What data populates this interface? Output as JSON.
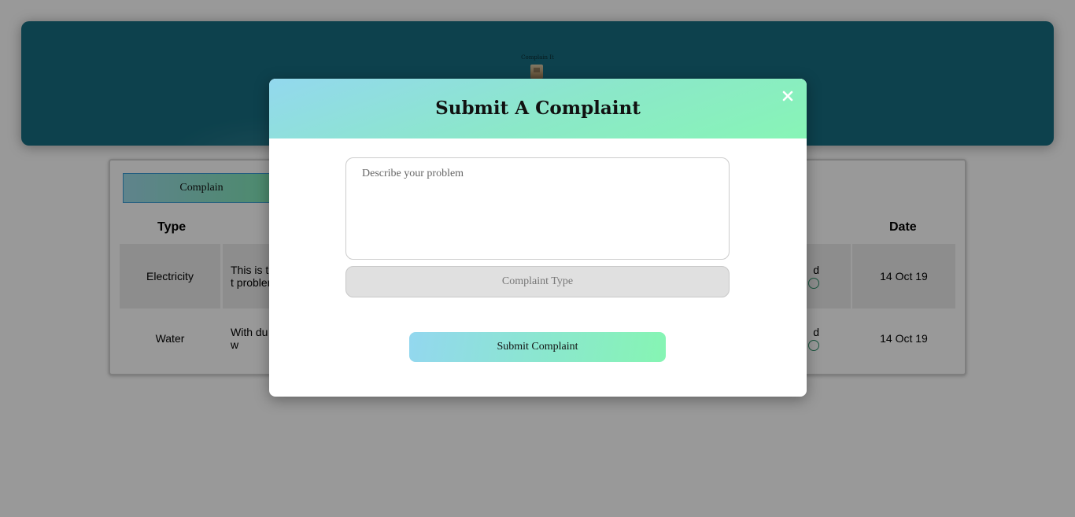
{
  "header": {
    "title": "Complain It",
    "logo_icon": "building-icon",
    "background_color": "#166d80"
  },
  "card": {
    "tab_label": "Complain",
    "columns": {
      "type": "Type",
      "date": "Date"
    },
    "rows": [
      {
        "type": "Electricity",
        "description": "This is t the past unable t problem",
        "status_fragment": "d",
        "date": "14 Oct 19"
      },
      {
        "type": "Water",
        "description": "With du XYZ. Du back I w",
        "status_fragment": "d",
        "date": "14 Oct 19"
      }
    ]
  },
  "modal": {
    "title": "Submit A Complaint",
    "close_icon": "close-icon",
    "description_placeholder": "Describe your problem",
    "description_value": "",
    "type_label": "Complaint Type",
    "submit_label": "Submit Complaint",
    "accent_gradient": [
      "#93d7ef",
      "#86f5b3"
    ]
  }
}
